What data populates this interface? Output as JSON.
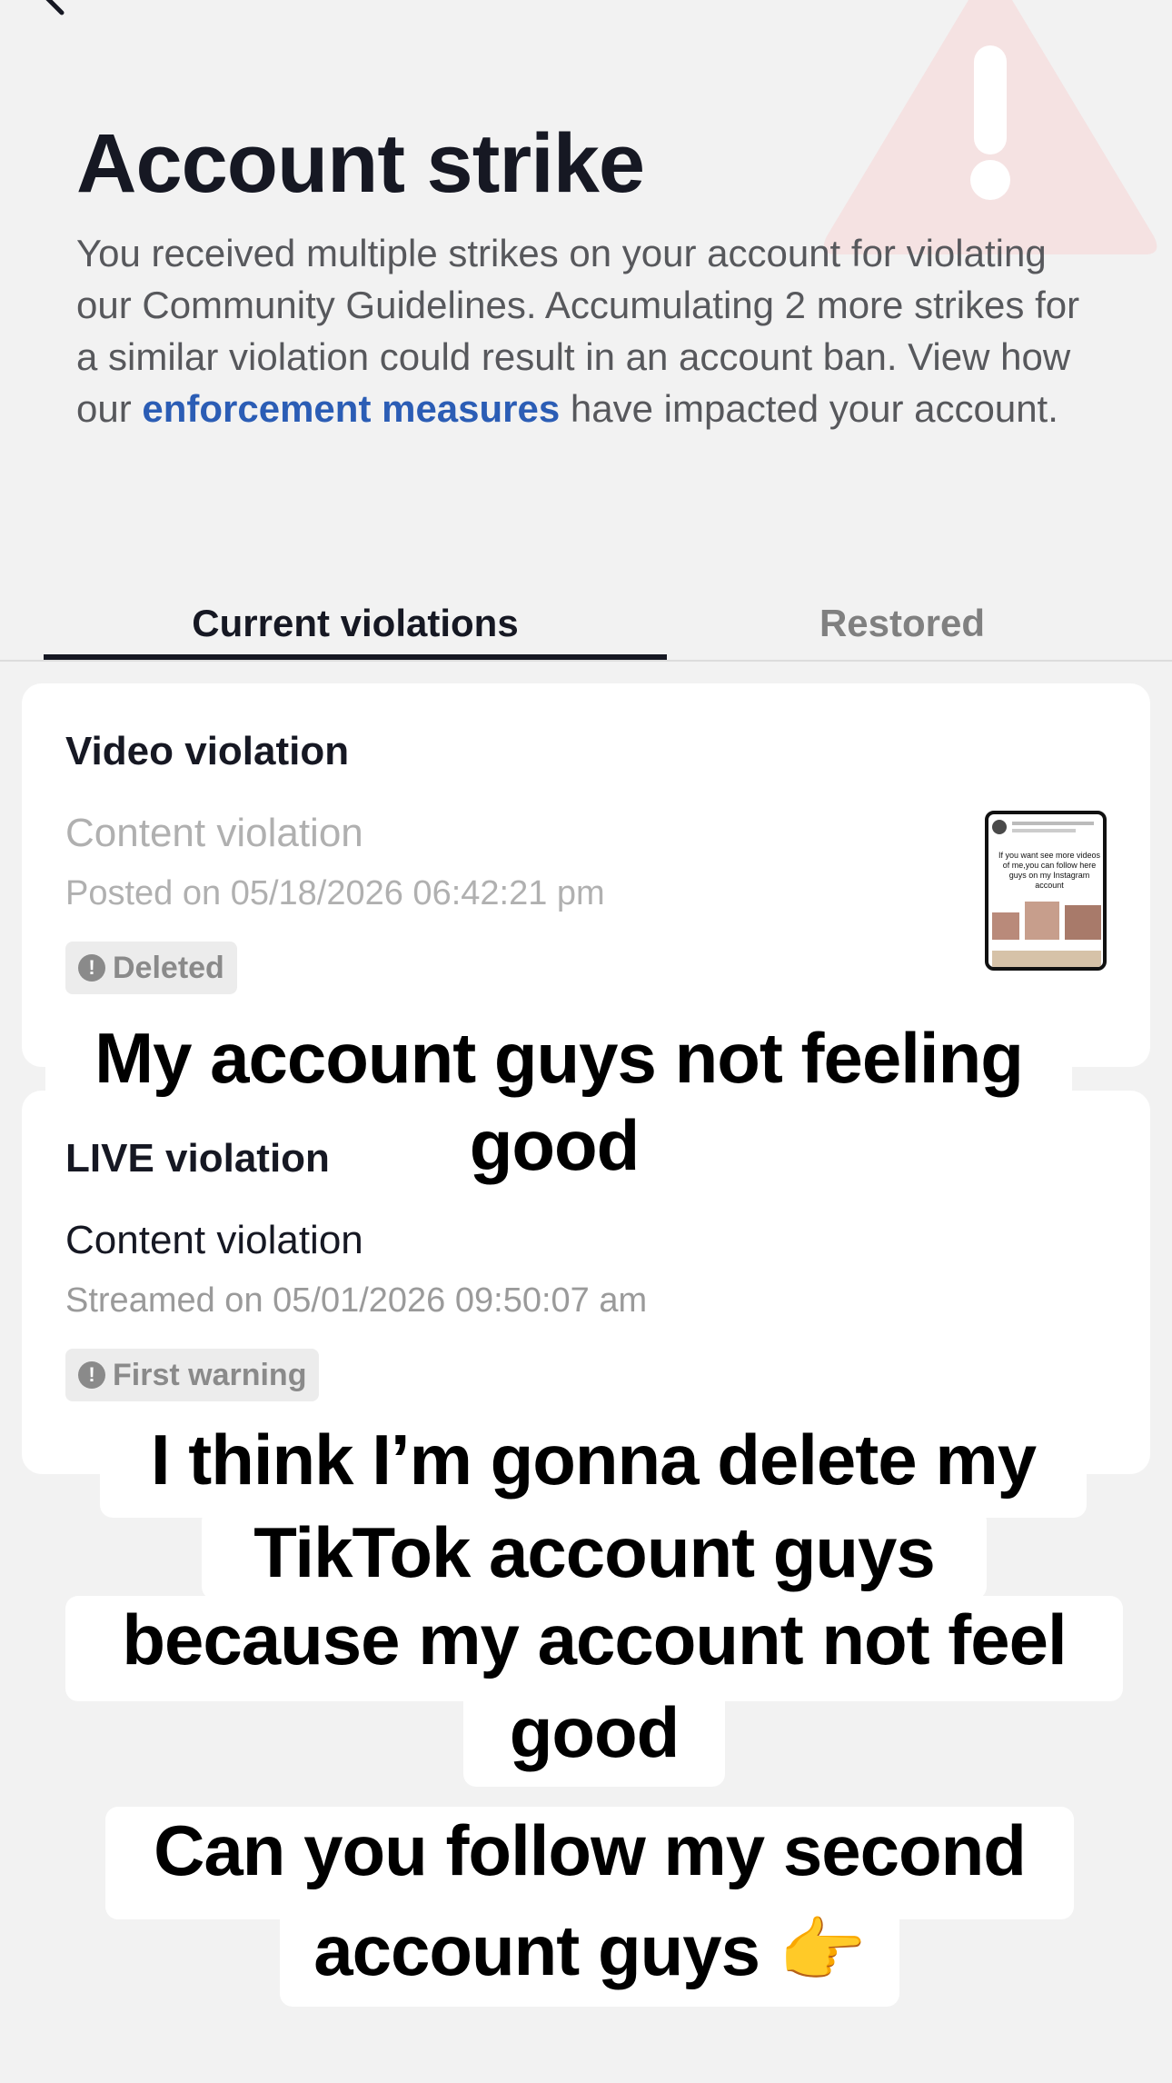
{
  "header": {
    "back_icon": "chevron-left-icon",
    "warning_icon": "warning-triangle-icon",
    "title": "Account strike",
    "description_before": "You received multiple strikes on your account for violating our Community Guidelines. Accumulating 2 more strikes for a similar violation could result in an account ban. View how our ",
    "description_link": "enforcement measures",
    "description_after": " have impacted your account."
  },
  "tabs": [
    {
      "label": "Current violations",
      "active": true
    },
    {
      "label": "Restored",
      "active": false
    }
  ],
  "violations": [
    {
      "heading": "Video violation",
      "type": "Content violation",
      "date": "Posted on 05/18/2026 06:42:21 pm",
      "status": "Deleted",
      "thumbnail_text": "If you want see more videos of me,you can follow here guys on my Instagram account"
    },
    {
      "heading": "LIVE violation",
      "type": "Content violation",
      "date": "Streamed on 05/01/2026 09:50:07 am",
      "status": "First warning"
    }
  ],
  "captions": [
    {
      "lines": [
        "My account guys not feeling",
        "good"
      ]
    },
    {
      "lines": [
        "I think I’m gonna delete my",
        "TikTok account guys",
        "because my account not feel",
        "good"
      ]
    },
    {
      "lines": [
        "Can you follow my second",
        "account guys 👉"
      ]
    }
  ],
  "colors": {
    "link": "#2b5db5",
    "warning_graphic": "#f6dcdc",
    "card_bg": "#ffffff",
    "page_bg": "#f2f2f2"
  }
}
